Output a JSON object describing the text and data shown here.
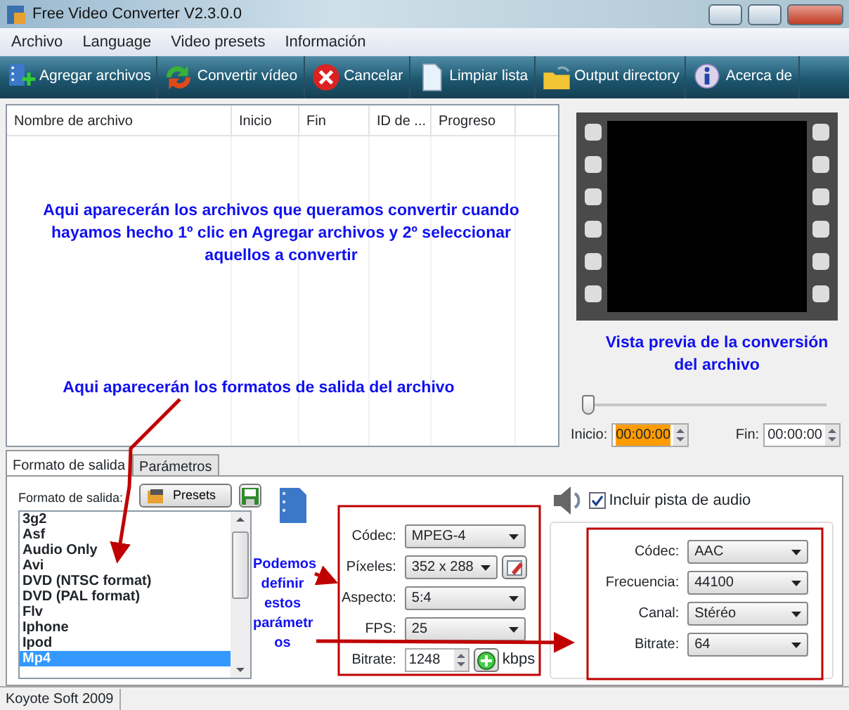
{
  "window": {
    "title": "Free Video Converter V2.3.0.0"
  },
  "menu": [
    "Archivo",
    "Language",
    "Video presets",
    "Información"
  ],
  "toolbar": [
    {
      "kind": "add",
      "label": "Agregar archivos"
    },
    {
      "kind": "convert",
      "label": "Convertir vídeo"
    },
    {
      "kind": "cancel",
      "label": "Cancelar"
    },
    {
      "kind": "clear",
      "label": "Limpiar lista"
    },
    {
      "kind": "folder",
      "label": "Output directory"
    },
    {
      "kind": "info",
      "label": "Acerca de"
    }
  ],
  "file_table": {
    "columns": [
      "Nombre de archivo",
      "Inicio",
      "Fin",
      "ID de ...",
      "Progreso"
    ]
  },
  "preview": {
    "slider": {
      "level": 0.0
    },
    "start_label": "Inicio:",
    "start": "00:00:00",
    "start_highlighted": true,
    "end_label": "Fin:",
    "end": "00:00:00"
  },
  "tabs": [
    {
      "label": "Formato de salida",
      "selected": true
    },
    {
      "label": "Parámetros",
      "selected": false
    }
  ],
  "output_format": {
    "label": "Formato de salida:",
    "presets_button": "Presets",
    "formats": [
      {
        "label": "3g2",
        "selected": false
      },
      {
        "label": "Asf",
        "selected": false
      },
      {
        "label": "Audio Only",
        "selected": false
      },
      {
        "label": "Avi",
        "selected": false
      },
      {
        "label": "DVD (NTSC format)",
        "selected": false
      },
      {
        "label": "DVD (PAL format)",
        "selected": false
      },
      {
        "label": "Flv",
        "selected": false
      },
      {
        "label": "Iphone",
        "selected": false
      },
      {
        "label": "Ipod",
        "selected": false
      },
      {
        "label": "Mp4",
        "selected": true
      }
    ]
  },
  "video": [
    {
      "kind": "select",
      "label": "Códec:",
      "value": "MPEG-4"
    },
    {
      "kind": "select_edit",
      "label": "Píxeles:",
      "value": "352 x 288"
    },
    {
      "kind": "select",
      "label": "Aspecto:",
      "value": "5:4"
    },
    {
      "kind": "select",
      "label": "FPS:",
      "value": "25"
    },
    {
      "kind": "spin",
      "label": "Bitrate:",
      "value": "1248",
      "unit": "kbps"
    }
  ],
  "audio": {
    "include_label": "Incluir pista de audio",
    "include": true,
    "fields": [
      {
        "label": "Códec:",
        "value": "AAC"
      },
      {
        "label": "Frecuencia:",
        "value": "44100"
      },
      {
        "label": "Canal:",
        "value": "Stéréo"
      },
      {
        "label": "Bitrate:",
        "value": "64"
      }
    ]
  },
  "status_bar": "Koyote Soft 2009",
  "annotations": [
    "Aqui aparecerán los archivos que queramos convertir cuando hayamos hecho 1º clic en Agregar archivos y 2º seleccionar aquellos a convertir",
    "Aqui aparecerán los formatos de salida del archivo",
    "Vista previa de la conversión del archivo",
    "Podemos definir estos parámetr os"
  ]
}
